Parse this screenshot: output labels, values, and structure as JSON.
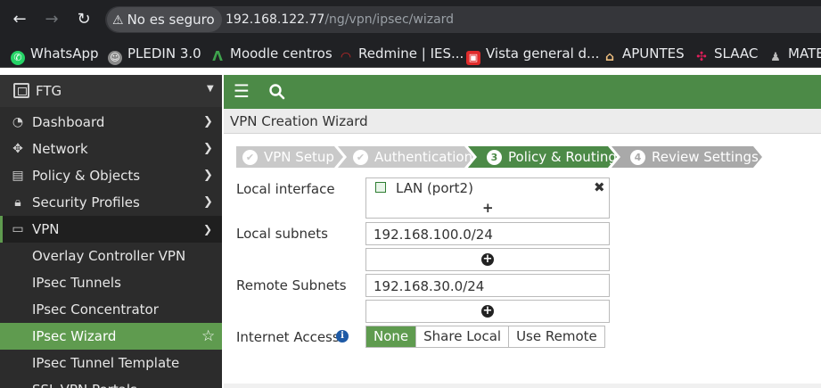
{
  "browser": {
    "security_label": "No es seguro",
    "url_host": "192.168.122.77",
    "url_path": "/ng/vpn/ipsec/wizard"
  },
  "bookmarks": [
    {
      "label": "WhatsApp",
      "icon": "whatsapp-icon",
      "color": "#25d366"
    },
    {
      "label": "PLEDIN 3.0",
      "icon": "pledin-icon",
      "color": "#8a8a8a"
    },
    {
      "label": "Moodle centros",
      "icon": "moodle-icon",
      "color": "#2e7d32"
    },
    {
      "label": "Redmine | IES...",
      "icon": "redmine-icon",
      "color": "#b32020"
    },
    {
      "label": "Vista general d...",
      "icon": "gitlab-icon",
      "color": "#e02b2b"
    },
    {
      "label": "APUNTES",
      "icon": "home-icon",
      "color": "#f0c080"
    },
    {
      "label": "SLAAC",
      "icon": "slack-icon",
      "color": "#e01e5a"
    },
    {
      "label": "MATE",
      "icon": "person-icon",
      "color": "#555555"
    }
  ],
  "sidebar": {
    "device": "FTG",
    "items": [
      {
        "label": "Dashboard",
        "icon": "dashboard-icon"
      },
      {
        "label": "Network",
        "icon": "network-icon"
      },
      {
        "label": "Policy & Objects",
        "icon": "policy-icon"
      },
      {
        "label": "Security Profiles",
        "icon": "lock-icon"
      },
      {
        "label": "VPN",
        "icon": "laptop-icon"
      }
    ],
    "vpn_subitems": [
      {
        "label": "Overlay Controller VPN"
      },
      {
        "label": "IPsec Tunnels"
      },
      {
        "label": "IPsec Concentrator"
      },
      {
        "label": "IPsec Wizard"
      },
      {
        "label": "IPsec Tunnel Template"
      },
      {
        "label": "SSL-VPN Portals"
      }
    ]
  },
  "page": {
    "title": "VPN Creation Wizard"
  },
  "steps": [
    {
      "marker": "✔",
      "label": "VPN Setup"
    },
    {
      "marker": "✔",
      "label": "Authentication"
    },
    {
      "marker": "3",
      "label": "Policy & Routing"
    },
    {
      "marker": "4",
      "label": "Review Settings"
    }
  ],
  "form": {
    "local_interface_label": "Local interface",
    "local_interface_value": "LAN (port2)",
    "local_interface_add": "+",
    "local_subnets_label": "Local subnets",
    "local_subnets_value": "192.168.100.0/24",
    "remote_subnets_label": "Remote Subnets",
    "remote_subnets_value": "192.168.30.0/24",
    "internet_access_label": "Internet Access",
    "internet_access_options": [
      "None",
      "Share Local",
      "Use Remote"
    ]
  },
  "colors": {
    "accent": "#4c8a47",
    "active": "#5f9b4f",
    "step_done": "#c9c9c9",
    "step_current": "#4c8a47",
    "step_todo": "#a9a9a9"
  }
}
